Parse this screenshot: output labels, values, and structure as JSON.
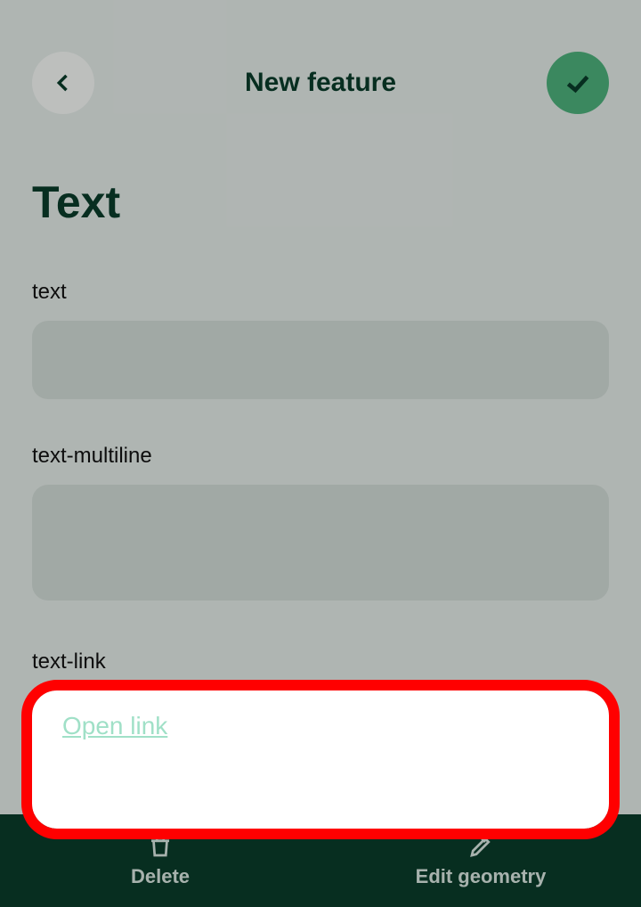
{
  "header": {
    "title": "New feature"
  },
  "section": {
    "title": "Text"
  },
  "fields": {
    "text": {
      "label": "text",
      "value": ""
    },
    "multiline": {
      "label": "text-multiline",
      "value": ""
    },
    "link": {
      "label": "text-link",
      "link_text": "Open link"
    }
  },
  "bottom": {
    "delete": "Delete",
    "edit_geometry": "Edit geometry"
  }
}
